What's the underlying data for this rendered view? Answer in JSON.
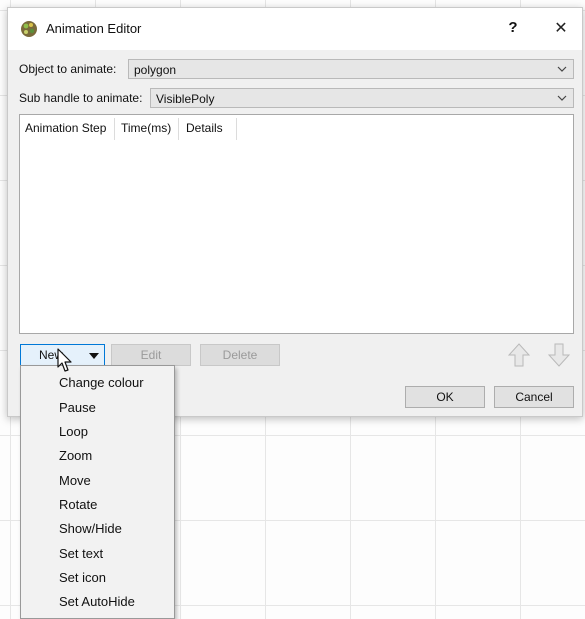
{
  "window": {
    "title": "Animation Editor",
    "help": "?",
    "close": "✕"
  },
  "object_row": {
    "label": "Object to animate:",
    "value": "polygon"
  },
  "subhandle_row": {
    "label": "Sub handle to animate:",
    "value": "VisiblePoly"
  },
  "list": {
    "columns": [
      "Animation Step",
      "Time(ms)",
      "Details"
    ]
  },
  "buttons": {
    "new": "New",
    "edit": "Edit",
    "delete": "Delete",
    "ok": "OK",
    "cancel": "Cancel"
  },
  "menu": {
    "items": [
      "Change colour",
      "Pause",
      "Loop",
      "Zoom",
      "Move",
      "Rotate",
      "Show/Hide",
      "Set text",
      "Set icon",
      "Set AutoHide"
    ]
  },
  "icons": {
    "app": "palette-icon",
    "combo": "chevron-down-icon",
    "move_up": "arrow-up-icon",
    "move_down": "arrow-down-icon",
    "cursor": "mouse-pointer-icon"
  },
  "colors": {
    "accent": "#0078d7",
    "dialog_bg": "#f0f0f0"
  }
}
